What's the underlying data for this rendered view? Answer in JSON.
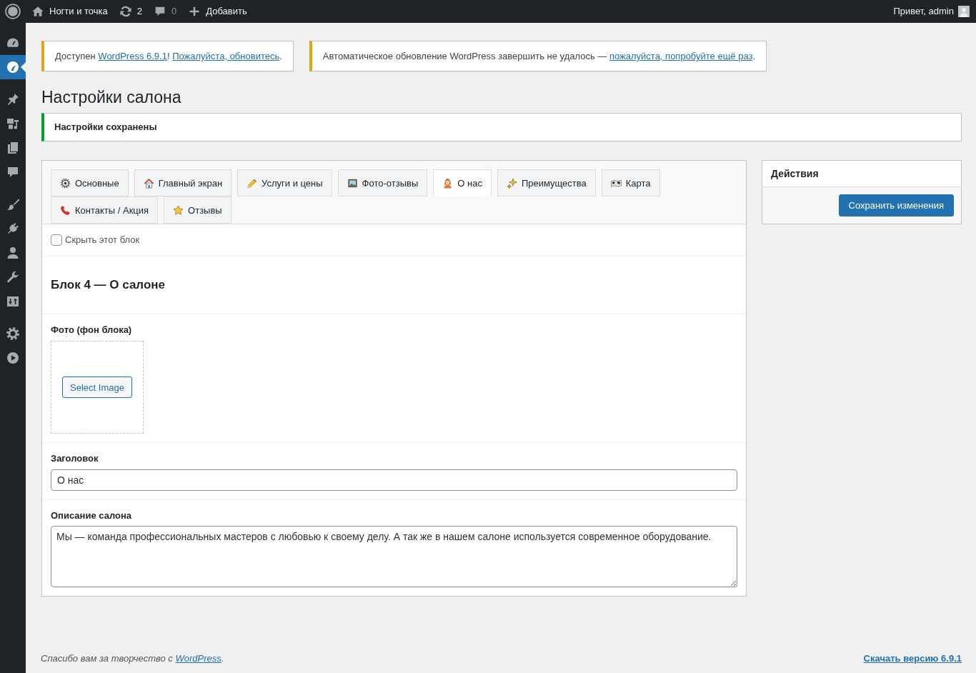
{
  "admin_bar": {
    "site_name": "Ногти и точка",
    "updates_count": "2",
    "comments_count": "0",
    "new_label": "Добавить",
    "greeting": "Привет, admin"
  },
  "sidebar": {
    "groups": [
      {
        "items": [
          {
            "selected": false
          },
          {
            "selected": true
          }
        ]
      },
      {
        "items": [
          {
            "selected": false
          },
          {
            "selected": false
          },
          {
            "selected": false
          },
          {
            "selected": false
          }
        ]
      },
      {
        "items": [
          {
            "selected": false
          },
          {
            "selected": false
          },
          {
            "selected": false
          },
          {
            "selected": false
          },
          {
            "selected": false
          }
        ]
      },
      {
        "items": [
          {
            "selected": false
          },
          {
            "selected": false
          }
        ]
      }
    ]
  },
  "update_notices": [
    {
      "kind": "warning",
      "segments": [
        {
          "kind": "text",
          "text": "Доступен "
        },
        {
          "kind": "link",
          "text": "WordPress 6.9.1"
        },
        {
          "kind": "text",
          "text": "! "
        },
        {
          "kind": "link",
          "text": "Пожалуйста, обновитесь"
        },
        {
          "kind": "text",
          "text": "."
        }
      ]
    },
    {
      "kind": "warning",
      "segments": [
        {
          "kind": "text",
          "text": "Автоматическое обновление WordPress завершить не удалось — "
        },
        {
          "kind": "link",
          "text": "пожалуйста, попробуйте ещё раз"
        },
        {
          "kind": "text",
          "text": "."
        }
      ]
    }
  ],
  "page_title": "Настройки салона",
  "saved_notice": {
    "kind": "success",
    "text": "Настройки сохранены"
  },
  "tabs": [
    {
      "label": "Основные",
      "selected": false
    },
    {
      "label": "Главный экран",
      "selected": false
    },
    {
      "label": "Услуги и цены",
      "selected": false
    },
    {
      "label": "Фото-отзывы",
      "selected": false
    },
    {
      "label": "О нас",
      "selected": true
    },
    {
      "label": "Преимущества",
      "selected": false
    },
    {
      "label": "Карта",
      "selected": false
    },
    {
      "label": "Контакты / Акция",
      "selected": false
    },
    {
      "label": "Отзывы",
      "selected": false
    }
  ],
  "hide_block": {
    "label": "Скрыть этот блок",
    "checked": false
  },
  "block_heading": "Блок 4 — О салоне",
  "photo_field": {
    "label": "Фото (фон блока)",
    "button": "Select Image"
  },
  "title_field": {
    "label": "Заголовок",
    "value": "О нас"
  },
  "description_field": {
    "label": "Описание салона",
    "value": "Мы — команда профессиональных мастеров с любовью к своему делу. А так же в нашем салоне используется современное оборудование."
  },
  "actions_box": {
    "title": "Действия",
    "button": "Сохранить изменения"
  },
  "footer": {
    "segments": [
      {
        "kind": "text",
        "text": "Спасибо вам за творчество с "
      },
      {
        "kind": "link",
        "text": "WordPress"
      },
      {
        "kind": "text",
        "text": "."
      }
    ],
    "version_link": "Скачать версию 6.9.1"
  }
}
